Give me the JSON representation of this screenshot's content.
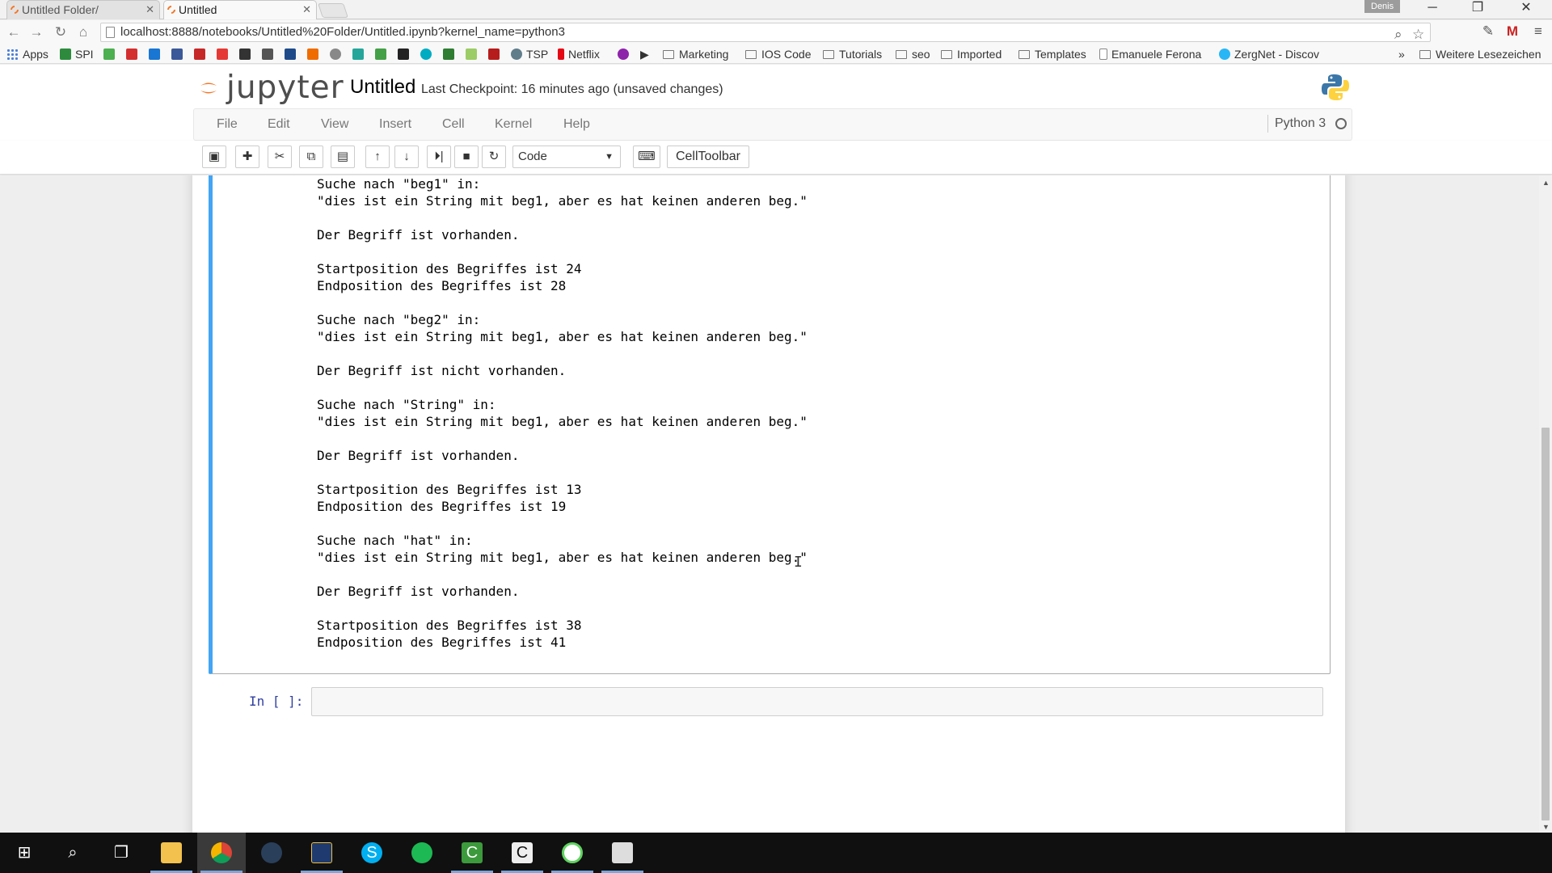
{
  "browser": {
    "tabs": [
      {
        "title": "Untitled Folder/",
        "active": false
      },
      {
        "title": "Untitled",
        "active": true
      }
    ],
    "user_badge": "Denis",
    "url": "localhost:8888/notebooks/Untitled%20Folder/Untitled.ipynb?kernel_name=python3",
    "bookmarks": [
      "Apps",
      "SPI",
      "TSP",
      "Netflix",
      "Marketing",
      "IOS Code",
      "Tutorials",
      "seo",
      "Imported",
      "Templates",
      "Emanuele Ferona",
      "ZergNet - Discov",
      "Weitere Lesezeichen"
    ],
    "overflow": "»"
  },
  "jupyter": {
    "logo_text": "jupyter",
    "notebook_title": "Untitled",
    "checkpoint": "Last Checkpoint: 16 minutes ago (unsaved changes)",
    "kernel_name": "Python 3",
    "menu": [
      "File",
      "Edit",
      "View",
      "Insert",
      "Cell",
      "Kernel",
      "Help"
    ],
    "cell_type": "Code",
    "celltoolbar_label": "CellToolbar",
    "next_prompt": "In [ ]:"
  },
  "output_lines": [
    "Suche nach \"beg1\" in:",
    "\"dies ist ein String mit beg1, aber es hat keinen anderen beg.\"",
    "",
    "Der Begriff ist vorhanden.",
    "",
    "Startposition des Begriffes ist 24",
    "Endposition des Begriffes ist 28",
    "",
    "Suche nach \"beg2\" in:",
    "\"dies ist ein String mit beg1, aber es hat keinen anderen beg.\"",
    "",
    "Der Begriff ist nicht vorhanden.",
    "",
    "Suche nach \"String\" in:",
    "\"dies ist ein String mit beg1, aber es hat keinen anderen beg.\"",
    "",
    "Der Begriff ist vorhanden.",
    "",
    "Startposition des Begriffes ist 13",
    "Endposition des Begriffes ist 19",
    "",
    "Suche nach \"hat\" in:",
    "\"dies ist ein String mit beg1, aber es hat keinen anderen beg.\"",
    "",
    "Der Begriff ist vorhanden.",
    "",
    "Startposition des Begriffes ist 38",
    "Endposition des Begriffes ist 41"
  ],
  "colors": {
    "jupyter_orange": "#f37726",
    "selected_cell_border": "#42a5f5",
    "prompt_blue": "#303f9f"
  }
}
